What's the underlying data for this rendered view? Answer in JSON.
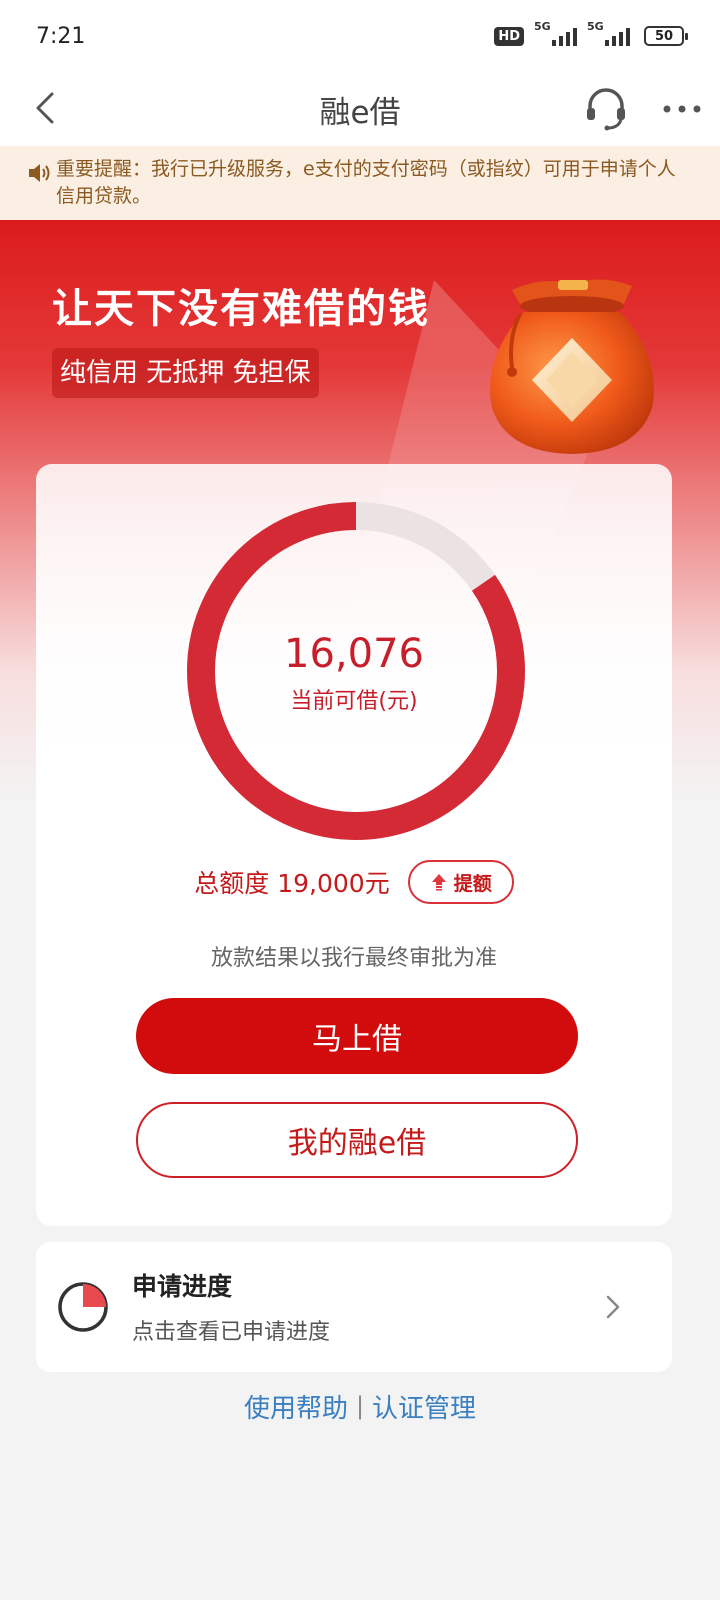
{
  "status_bar": {
    "time": "7:21",
    "hd_badge": "HD",
    "network_1": "5G",
    "network_2": "5G",
    "battery": "50"
  },
  "nav": {
    "title": "融e借",
    "back_icon": "chevron-left-icon",
    "service_icon": "headset-icon",
    "more_icon": "more-icon"
  },
  "notice": {
    "icon": "speaker-icon",
    "text": "重要提醒：我行已升级服务，e支付的支付密码（或指纹）可用于申请个人信用贷款。"
  },
  "hero": {
    "title": "让天下没有难借的钱",
    "tags": "纯信用 无抵押 免担保"
  },
  "loan": {
    "available_amount": "16,076",
    "available_label": "当前可借(元)",
    "available_fraction": 0.846,
    "total_limit": "总额度 19,000元",
    "raise_label": "提额",
    "disclaimer": "放款结果以我行最终审批为准",
    "borrow_button": "马上借",
    "my_loan_button": "我的融e借"
  },
  "progress": {
    "title": "申请进度",
    "subtitle": "点击查看已申请进度"
  },
  "footer": {
    "help_link": "使用帮助",
    "separator": "|",
    "auth_link": "认证管理"
  },
  "colors": {
    "brand_red": "#d20c0c",
    "ring_red": "#d42a36",
    "ring_track": "#ebe3e3",
    "link_blue": "#3a7fc0",
    "notice_bg": "#fbefe3"
  }
}
